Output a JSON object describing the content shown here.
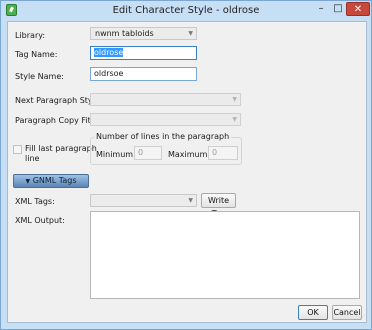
{
  "window": {
    "title": "Edit Character Style - oldrose",
    "min_glyph": "–",
    "max_glyph": "□",
    "close_glyph": "✕"
  },
  "form": {
    "library": {
      "label": "Library:",
      "value": "nwnm tabloids"
    },
    "tag_name": {
      "label": "Tag Name:",
      "value": "oldrose"
    },
    "style_name": {
      "label": "Style Name:",
      "value": "oldrsoe"
    },
    "next_paragraph_style": {
      "label": "Next Paragraph Style:",
      "value": ""
    },
    "paragraph_copy_fit": {
      "label": "Paragraph Copy Fit:",
      "value": ""
    },
    "fill_last_paragraph_line": {
      "label_line1": "Fill last paragraph",
      "label_line2": "line",
      "checked": false
    },
    "lines_group": {
      "title": "Number of lines in the paragraph",
      "minimum_label": "Minimum:",
      "minimum_value": "0",
      "maximum_label": "Maximum:",
      "maximum_value": "0"
    },
    "gnml_tags": {
      "label": "GNML Tags",
      "expander_glyph": "▼",
      "expanded": true
    },
    "xml_tags": {
      "label": "XML Tags:",
      "value": "",
      "write_tag_label": "Write Tag"
    },
    "xml_output": {
      "label": "XML Output:",
      "value": ""
    }
  },
  "footer": {
    "ok_label": "OK",
    "cancel_label": "Cancel"
  },
  "icons": {
    "combo_arrow": "▼",
    "resize_grip": "⋰"
  },
  "colors": {
    "accent": "#3c7fc1",
    "titlebar": "#c7dff4",
    "close": "#c9483c",
    "selection": "#3399ff"
  }
}
